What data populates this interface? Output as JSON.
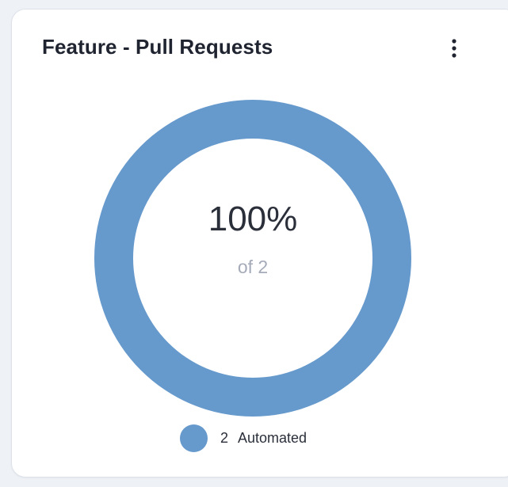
{
  "widget": {
    "title": "Feature - Pull Requests",
    "menu_icon": "more-vertical-icon"
  },
  "center": {
    "value": "100%",
    "subtitle": "of 2"
  },
  "legend": [
    {
      "count": "2",
      "label": "Automated",
      "color": "#6699cc"
    }
  ],
  "colors": {
    "series": "#6699cc",
    "card_bg": "#ffffff",
    "page_bg": "#eef1f6"
  },
  "chart_data": {
    "type": "pie",
    "title": "Feature - Pull Requests",
    "categories": [
      "Automated"
    ],
    "values": [
      2
    ],
    "total": 2,
    "percent": 100,
    "legend_position": "bottom"
  }
}
